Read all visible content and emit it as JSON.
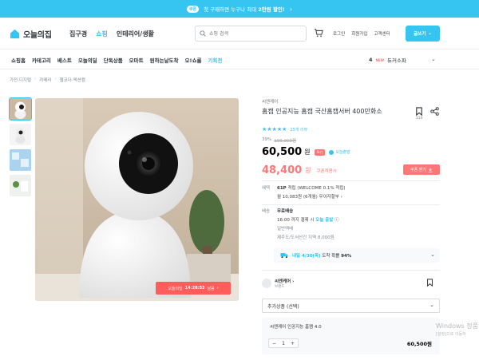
{
  "promo": {
    "tag": "쿠폰",
    "text_prefix": "첫 구매하면 누구나 최대 ",
    "text_bold": "2만원 할인!",
    "arrow": "›"
  },
  "header": {
    "logo_text": "오늘의집",
    "nav": [
      "집구경",
      "쇼핑",
      "인테리어/생활"
    ],
    "search_placeholder": "쇼핑 검색",
    "util_links": [
      "로그인",
      "회원가입",
      "고객센터"
    ],
    "write_button": "글쓰기",
    "write_chevron": "⌄"
  },
  "subnav": {
    "items": [
      "쇼핑홈",
      "카테고리",
      "베스트",
      "오늘의딜",
      "단독상품",
      "오마트",
      "원하는날도착",
      "오!쇼룸",
      "기획전"
    ],
    "rank_number": "4",
    "rank_badge": "NEW",
    "rank_keyword": "듀커소파",
    "chevron": "⌄"
  },
  "breadcrumb": [
    "가전·디지털",
    "카메라",
    "웹코더·액션캠"
  ],
  "product": {
    "brand": "씨엔케어",
    "title": "홈캠 인공지능 홈캠 국산홈캠서버 400만화소",
    "bookmark_count": "114",
    "stars": "★★★★★",
    "review_count": "25개 리뷰",
    "discount_rate": "39%",
    "original_price": "100,000원",
    "price": "60,500",
    "won": "원",
    "special_badge": "특가",
    "today_badge": "오늘출발",
    "coupon_price": "48,400",
    "coupon_label": "쿠폰적용시",
    "coupon_button": "쿠폰 받기",
    "timer_label": "오늘의딜",
    "timer_time": "14:28:53",
    "timer_suffix": "남음",
    "timer_arrow": "›",
    "points_label": "혜택",
    "points_value": "61P",
    "points_text": "적립 (WELCOME 0.1% 적립)",
    "installment": "월 10,083원 (6개월) 무이자할부",
    "installment_arrow": "›",
    "delivery_label": "배송",
    "delivery_free": "무료배송",
    "delivery_today_prefix": "16:00 까지 결제 시",
    "delivery_today_strong": "오늘 출발",
    "delivery_info_icon": "ⓘ",
    "delivery_type": "일반택배",
    "delivery_extra": "제주도/도서산간 지역 8,000원",
    "arrival_strong": "내일 4/30(목)",
    "arrival_text": "도착 확률",
    "arrival_pct": "94%",
    "arrival_chevron": "⌄",
    "seller_name": "씨엔케어",
    "seller_arrow": "›",
    "seller_sub": "브랜드",
    "option_placeholder": "추가상품 (선택)",
    "option_chevron": "⌄",
    "selected_name": "씨엔케어 인공지능 홈캠 4.0",
    "qty_minus": "−",
    "qty_value": "1",
    "qty_plus": "+",
    "selected_price": "60,500원",
    "watermark_title": "Windows 정품",
    "watermark_sub": "[설정]으로 이동하"
  },
  "colors": {
    "accent": "#35c5f0",
    "sale": "#ff7777",
    "text": "#2f3438"
  },
  "icons": [
    "house-logo-icon",
    "search-icon",
    "cart-icon",
    "pencil-icon",
    "bookmark-icon",
    "share-icon",
    "download-icon",
    "truck-icon",
    "chevron-down-icon"
  ]
}
